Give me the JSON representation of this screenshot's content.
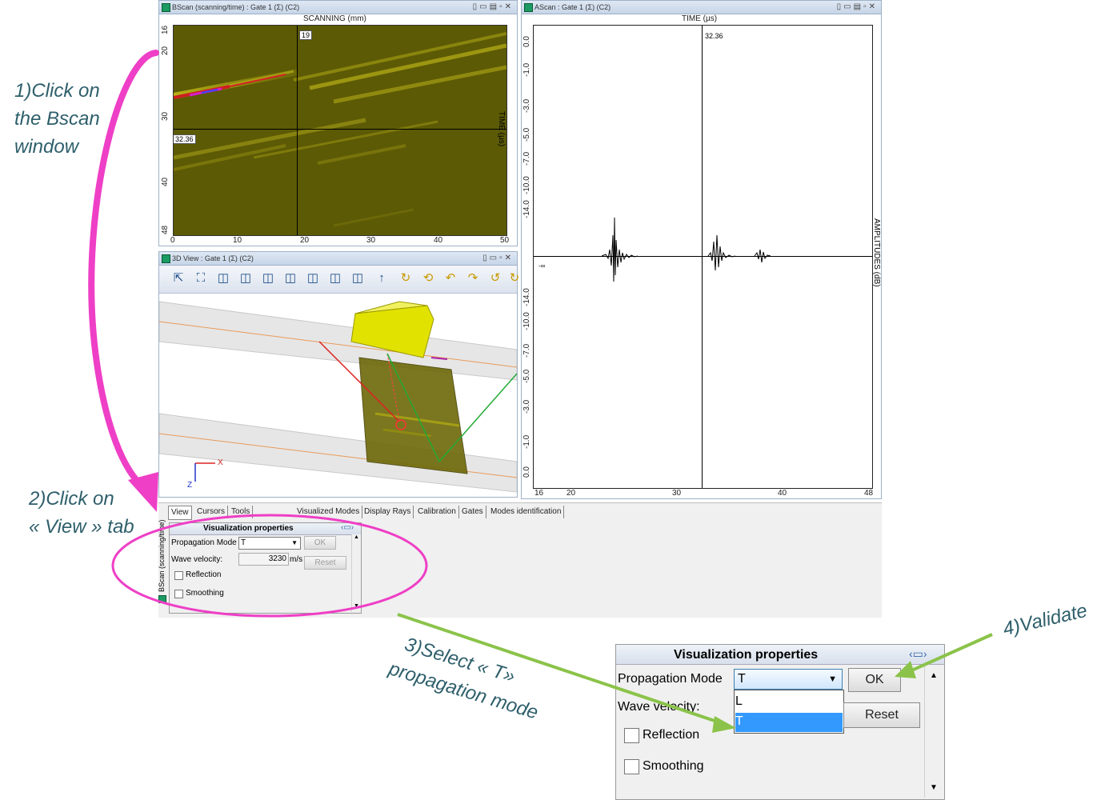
{
  "annotations": {
    "step1": [
      "1)Click on",
      "the Bscan",
      "window"
    ],
    "step2": [
      "2)Click on",
      "« View » tab"
    ],
    "step3": [
      "3)Select « T»",
      "propagation mode"
    ],
    "step4": "4)Validate"
  },
  "bscan": {
    "title": "BScan (scanning/time) : Gate 1 (Σ) (C2)",
    "x_axis_label": "SCANNING (mm)",
    "y_axis_label": "TIME (µs)",
    "x_ticks": [
      "0",
      "10",
      "20",
      "30",
      "40",
      "50"
    ],
    "y_ticks": [
      "16",
      "20",
      "30",
      "40",
      "48"
    ],
    "cursor_x_label": "19",
    "cursor_y_label": "32.36"
  },
  "ascan": {
    "title": "AScan : Gate 1 (Σ) (C2)",
    "x_axis_label": "TIME (µs)",
    "y_axis_label": "AMPLITUDES (dB)",
    "cursor_label": "32.36",
    "x_ticks": [
      "16",
      "20",
      "30",
      "40",
      "48"
    ],
    "y_ticks_top": [
      "0.0",
      "-1.0",
      "-3.0",
      "-5.0",
      "-7.0",
      "-10.0",
      "-14.0"
    ],
    "y_ticks_bottom": [
      "-14.0",
      "-10.0",
      "-7.0",
      "-5.0",
      "-3.0",
      "-1.0",
      "0.0"
    ],
    "center_label": "-∞"
  },
  "view3d": {
    "title": "3D View : Gate 1 (Σ) (C2)",
    "axis_x": "X",
    "axis_z": "Z"
  },
  "tabs": [
    "View",
    "Cursors",
    "Tools",
    "Visualized Modes",
    "Display Rays",
    "Calibration",
    "Gates",
    "Modes identification"
  ],
  "side_label": "BScan (scanning/time)",
  "vis_props": {
    "title": "Visualization properties",
    "propagation_label": "Propagation Mode",
    "propagation_value": "T",
    "ok_label": "OK",
    "reset_label": "Reset",
    "velocity_label": "Wave velocity:",
    "velocity_value": "3230",
    "velocity_unit": "m/s",
    "reflection_label": "Reflection",
    "smoothing_label": "Smoothing"
  },
  "zoom_props": {
    "title": "Visualization properties",
    "propagation_label": "Propagation Mode",
    "propagation_value": "T",
    "ok_label": "OK",
    "reset_label": "Reset",
    "velocity_label": "Wave velocity:",
    "options": [
      "L",
      "T"
    ],
    "selected_option": "T",
    "reflection_label": "Reflection",
    "smoothing_label": "Smoothing"
  },
  "colors": {
    "magenta_arrow": "#ee3fc6",
    "green_arrow": "#8bc34a",
    "bscan_bg": "#5c5a05",
    "selection_blue": "#3399ff"
  }
}
